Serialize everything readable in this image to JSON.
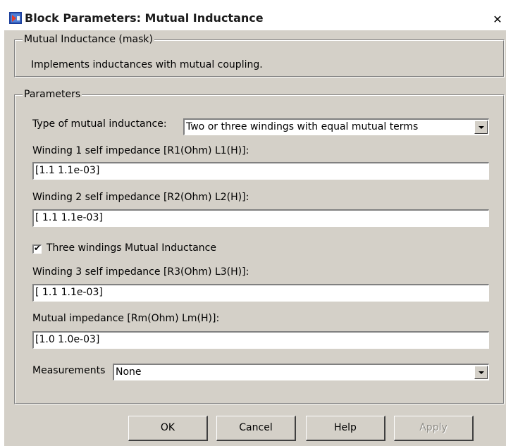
{
  "window": {
    "title": "Block Parameters: Mutual Inductance",
    "close_glyph": "✕",
    "icon": "simulink-block-icon"
  },
  "mask": {
    "legend": "Mutual Inductance (mask)",
    "description": "Implements inductances with mutual coupling."
  },
  "parameters": {
    "legend": "Parameters",
    "type_label": "Type of mutual inductance:",
    "type_value": "Two or three windings with equal mutual terms",
    "winding1_label": "Winding 1 self impedance [R1(Ohm) L1(H)]:",
    "winding1_value": "[1.1 1.1e-03]",
    "winding2_label": "Winding 2 self impedance [R2(Ohm) L2(H)]:",
    "winding2_value": "[ 1.1 1.1e-03]",
    "three_windings_label": "Three windings Mutual Inductance",
    "three_windings_checked": true,
    "winding3_label": "Winding 3 self impedance [R3(Ohm) L3(H)]:",
    "winding3_value": "[ 1.1 1.1e-03]",
    "mutual_label": "Mutual impedance [Rm(Ohm) Lm(H)]:",
    "mutual_value": "[1.0 1.0e-03]",
    "measurements_label": "Measurements",
    "measurements_value": "None"
  },
  "buttons": {
    "ok": "OK",
    "cancel": "Cancel",
    "help": "Help",
    "apply": "Apply"
  },
  "colors": {
    "dialog_bg": "#d4d0c8",
    "field_bg": "#ffffff",
    "disabled_text": "#8e8c86"
  }
}
